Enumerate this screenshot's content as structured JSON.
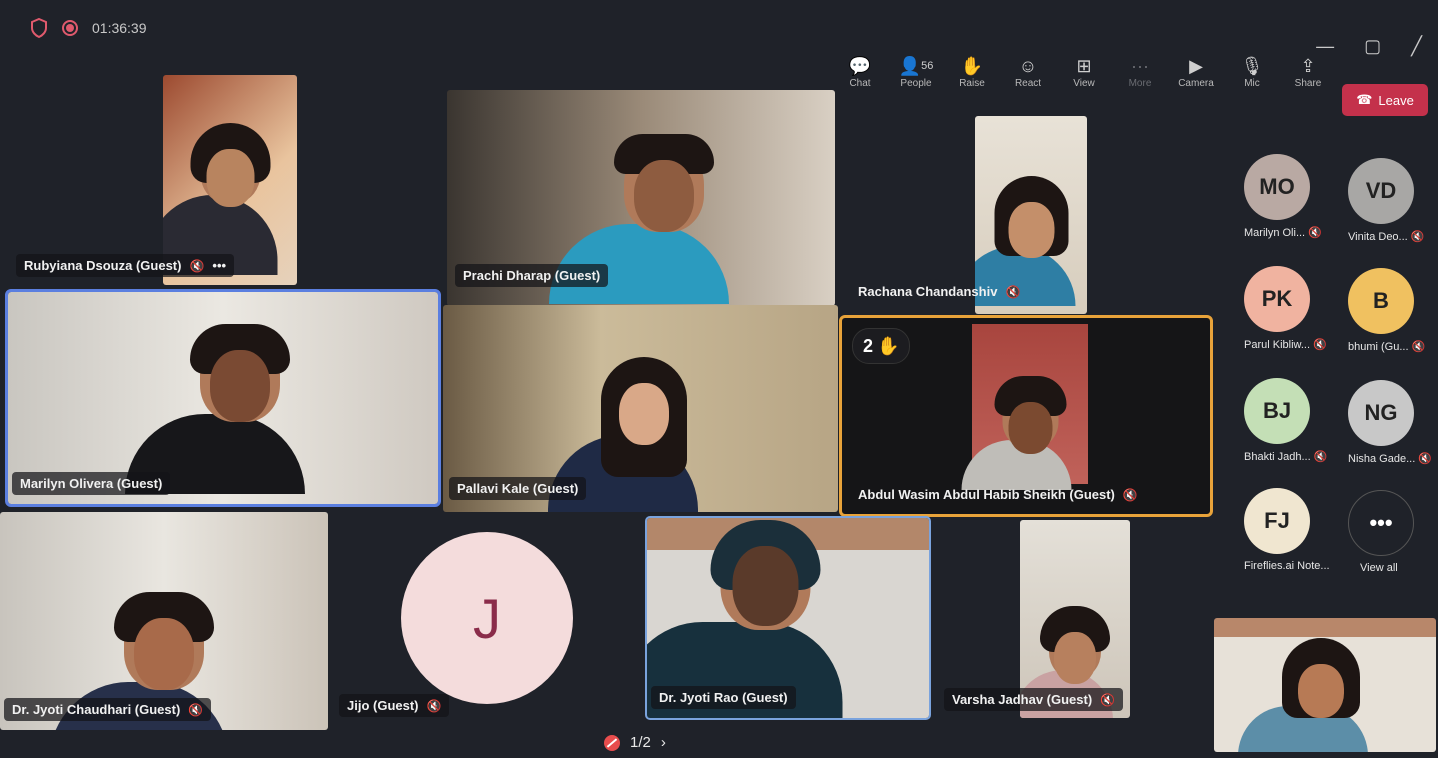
{
  "recording": {
    "timer": "01:36:39"
  },
  "toolbar": {
    "chat": "Chat",
    "people": "People",
    "people_count": "56",
    "raise": "Raise",
    "react": "React",
    "view": "View",
    "more": "More",
    "camera": "Camera",
    "mic": "Mic",
    "share": "Share",
    "leave": "Leave"
  },
  "tiles": {
    "rubyiana": "Rubyiana Dsouza (Guest)",
    "prachi": "Prachi Dharap (Guest)",
    "rachana": "Rachana Chandanshiv",
    "marilyn": "Marilyn Olivera (Guest)",
    "pallavi": "Pallavi Kale (Guest)",
    "abdul": "Abdul Wasim Abdul Habib Sheikh (Guest)",
    "abdul_hand_count": "2",
    "jyoti_c": "Dr. Jyoti Chaudhari (Guest)",
    "jijo": "Jijo (Guest)",
    "jijo_initial": "J",
    "jyoti_r": "Dr. Jyoti Rao (Guest)",
    "varsha": "Varsha Jadhav (Guest)"
  },
  "sidebar": [
    {
      "initials": "MO",
      "label": "Marilyn Oli...",
      "color": "#b9a9a3"
    },
    {
      "initials": "VD",
      "label": "Vinita Deo...",
      "color": "#a8a7a5"
    },
    {
      "initials": "PK",
      "label": "Parul Kibliw...",
      "color": "#f0b3a0"
    },
    {
      "initials": "B",
      "label": "bhumi (Gu...",
      "color": "#f0c160"
    },
    {
      "initials": "BJ",
      "label": "Bhakti Jadh...",
      "color": "#c4dfb6"
    },
    {
      "initials": "NG",
      "label": "Nisha Gade...",
      "color": "#c8c8c8"
    },
    {
      "initials": "FJ",
      "label": "Fireflies.ai Note...",
      "color": "#f0e6d0"
    }
  ],
  "view_all": "View all",
  "pager": {
    "page": "1/2"
  }
}
